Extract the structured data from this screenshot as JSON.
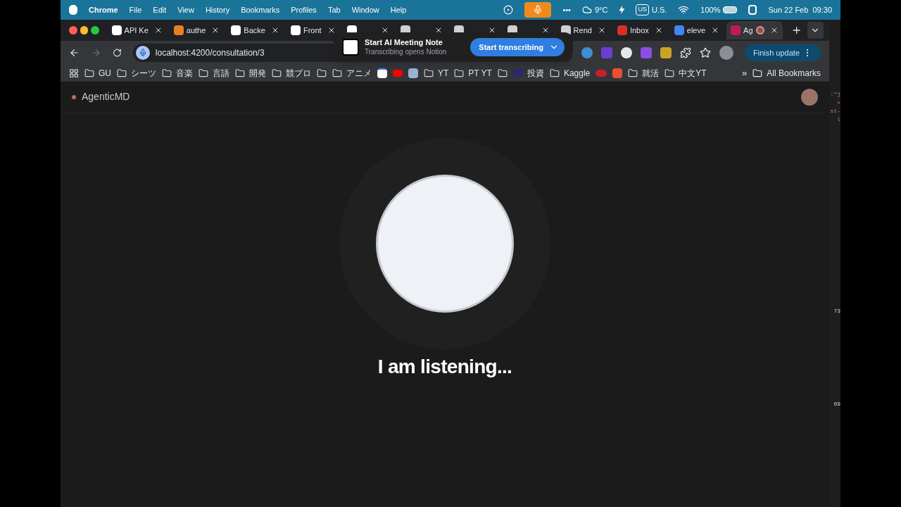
{
  "menubar": {
    "app": "Chrome",
    "items": [
      "File",
      "Edit",
      "View",
      "History",
      "Bookmarks",
      "Profiles",
      "Tab",
      "Window",
      "Help"
    ],
    "weather": "9°C",
    "input_source": "U.S.",
    "input_badge": "US",
    "battery": "100%",
    "more": "•••",
    "datetime": "Sun 22 Feb  09:30",
    "mic_active": true
  },
  "tabs": [
    {
      "label": "API Ke",
      "kind": "openai",
      "selected": false
    },
    {
      "label": "authe",
      "kind": "stack",
      "selected": false
    },
    {
      "label": "Backe",
      "kind": "render",
      "selected": false
    },
    {
      "label": "Front",
      "kind": "render",
      "selected": false
    },
    {
      "kind": "render",
      "selected": false
    },
    {
      "kind": "github",
      "selected": false
    },
    {
      "kind": "github",
      "selected": false
    },
    {
      "kind": "github",
      "selected": false
    },
    {
      "label": "Rend",
      "kind": "github",
      "selected": false
    },
    {
      "label": "Inbox",
      "kind": "gmail",
      "selected": false
    },
    {
      "label": "eleve",
      "kind": "google",
      "selected": false
    },
    {
      "label": "Ag",
      "kind": "angular",
      "selected": true,
      "recording": true
    }
  ],
  "address_bar": {
    "url": "localhost:4200/consultation/3"
  },
  "profile_button": {
    "label": "Finish update"
  },
  "bookmarks": [
    {
      "label": "GU",
      "kind": "folder"
    },
    {
      "label": "シーツ",
      "kind": "folder"
    },
    {
      "label": "音楽",
      "kind": "folder"
    },
    {
      "label": "言語",
      "kind": "folder"
    },
    {
      "label": "開発",
      "kind": "folder"
    },
    {
      "label": "競プロ",
      "kind": "folder"
    },
    {
      "kind": "folder"
    },
    {
      "label": "アニメ",
      "kind": "folder"
    },
    {
      "kind": "calendar"
    },
    {
      "kind": "youtube"
    },
    {
      "kind": "image"
    },
    {
      "label": "YT",
      "kind": "folder"
    },
    {
      "label": "PT YT",
      "kind": "folder"
    },
    {
      "kind": "folder"
    },
    {
      "label": "投資",
      "kind": "hl"
    },
    {
      "label": "Kaggle",
      "kind": "folder"
    },
    {
      "kind": "lips"
    },
    {
      "kind": "office"
    },
    {
      "label": "就活",
      "kind": "folder"
    },
    {
      "label": "中文YT",
      "kind": "folder"
    }
  ],
  "bookmarks_more": "»",
  "all_bookmarks": "All Bookmarks",
  "notion_popup": {
    "title": "Start AI Meeting Note",
    "subtitle": "Transcribing opens Notion",
    "button": "Start transcribing"
  },
  "app": {
    "brand": "AgenticMD",
    "message": "I am listening..."
  },
  "editor_strip": {
    "fragments": [
      ":\"j",
      ">",
      "st-",
      "l"
    ],
    "line_numbers": [
      "73",
      "69"
    ]
  }
}
